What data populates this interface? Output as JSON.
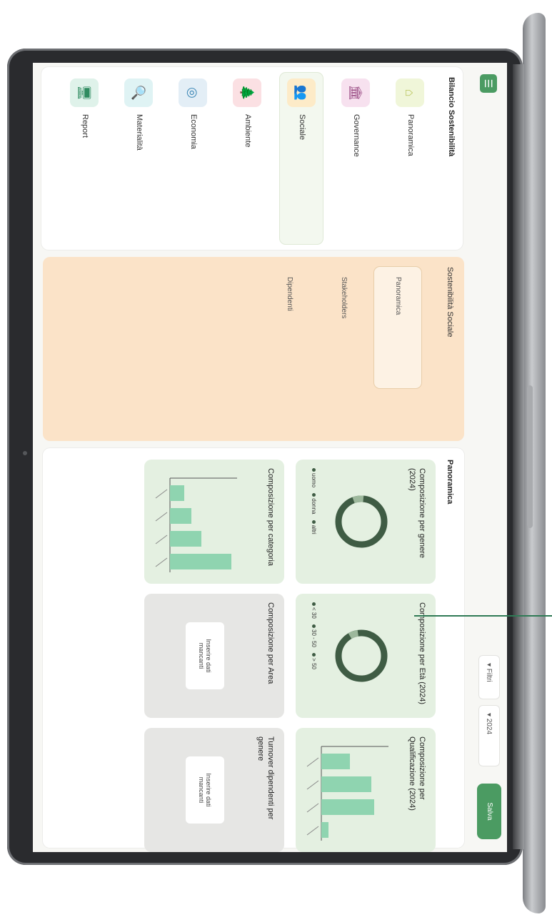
{
  "topbar": {
    "menu_icon": "☰",
    "filter_1": "▾ Filtri",
    "filter_2": "▾ 2024",
    "save_label": "Salva"
  },
  "sidebar": {
    "title": "Bilancio Sostenibilità",
    "items": [
      {
        "label": "Panoramica",
        "icon": "home-icon",
        "glyph": "⌂",
        "bg": "#f0f6d9"
      },
      {
        "label": "Governance",
        "icon": "bank-icon",
        "glyph": "🏛",
        "bg": "#f7e1ef"
      },
      {
        "label": "Sociale",
        "icon": "people-icon",
        "glyph": "👥",
        "bg": "#fdebc8",
        "active": true
      },
      {
        "label": "Ambiente",
        "icon": "tree-icon",
        "glyph": "🌲",
        "bg": "#fbe0e3"
      },
      {
        "label": "Economia",
        "icon": "target-icon",
        "glyph": "◎",
        "bg": "#e3eef6"
      },
      {
        "label": "Materialità",
        "icon": "magnifier-icon",
        "glyph": "🔍",
        "bg": "#dff3f4"
      },
      {
        "label": "Report",
        "icon": "monitor-icon",
        "glyph": "🖥",
        "bg": "#dff2ea"
      }
    ]
  },
  "subpanel": {
    "title": "Sostenibilità Sociale",
    "items": [
      {
        "label": "Panoramica",
        "active": true
      },
      {
        "label": "Stakeholders"
      },
      {
        "label": "Dipendenti"
      }
    ]
  },
  "main": {
    "title": "Panoramica",
    "cards": [
      {
        "title": "Composizione per genere (2024)",
        "kind": "donut",
        "legend": [
          "uomo",
          "donna",
          "altri"
        ]
      },
      {
        "title": "Composizione per Età (2024)",
        "kind": "donut",
        "legend": [
          "< 30",
          "30 - 50",
          "> 50"
        ]
      },
      {
        "title": "Composizione per Qualificazione (2024)",
        "kind": "bars"
      },
      {
        "title": "Composizione per categoria",
        "kind": "bars"
      },
      {
        "title": "Composizione per Area",
        "kind": "nodata",
        "message": "Inserire dati mancanti"
      },
      {
        "title": "Turnover dipendenti per genere",
        "kind": "nodata",
        "message": "Inserire dati mancanti"
      }
    ]
  },
  "colors": {
    "accent": "#4b9b62",
    "bar": "#8fd4b0",
    "donut": "#3f5c44"
  }
}
